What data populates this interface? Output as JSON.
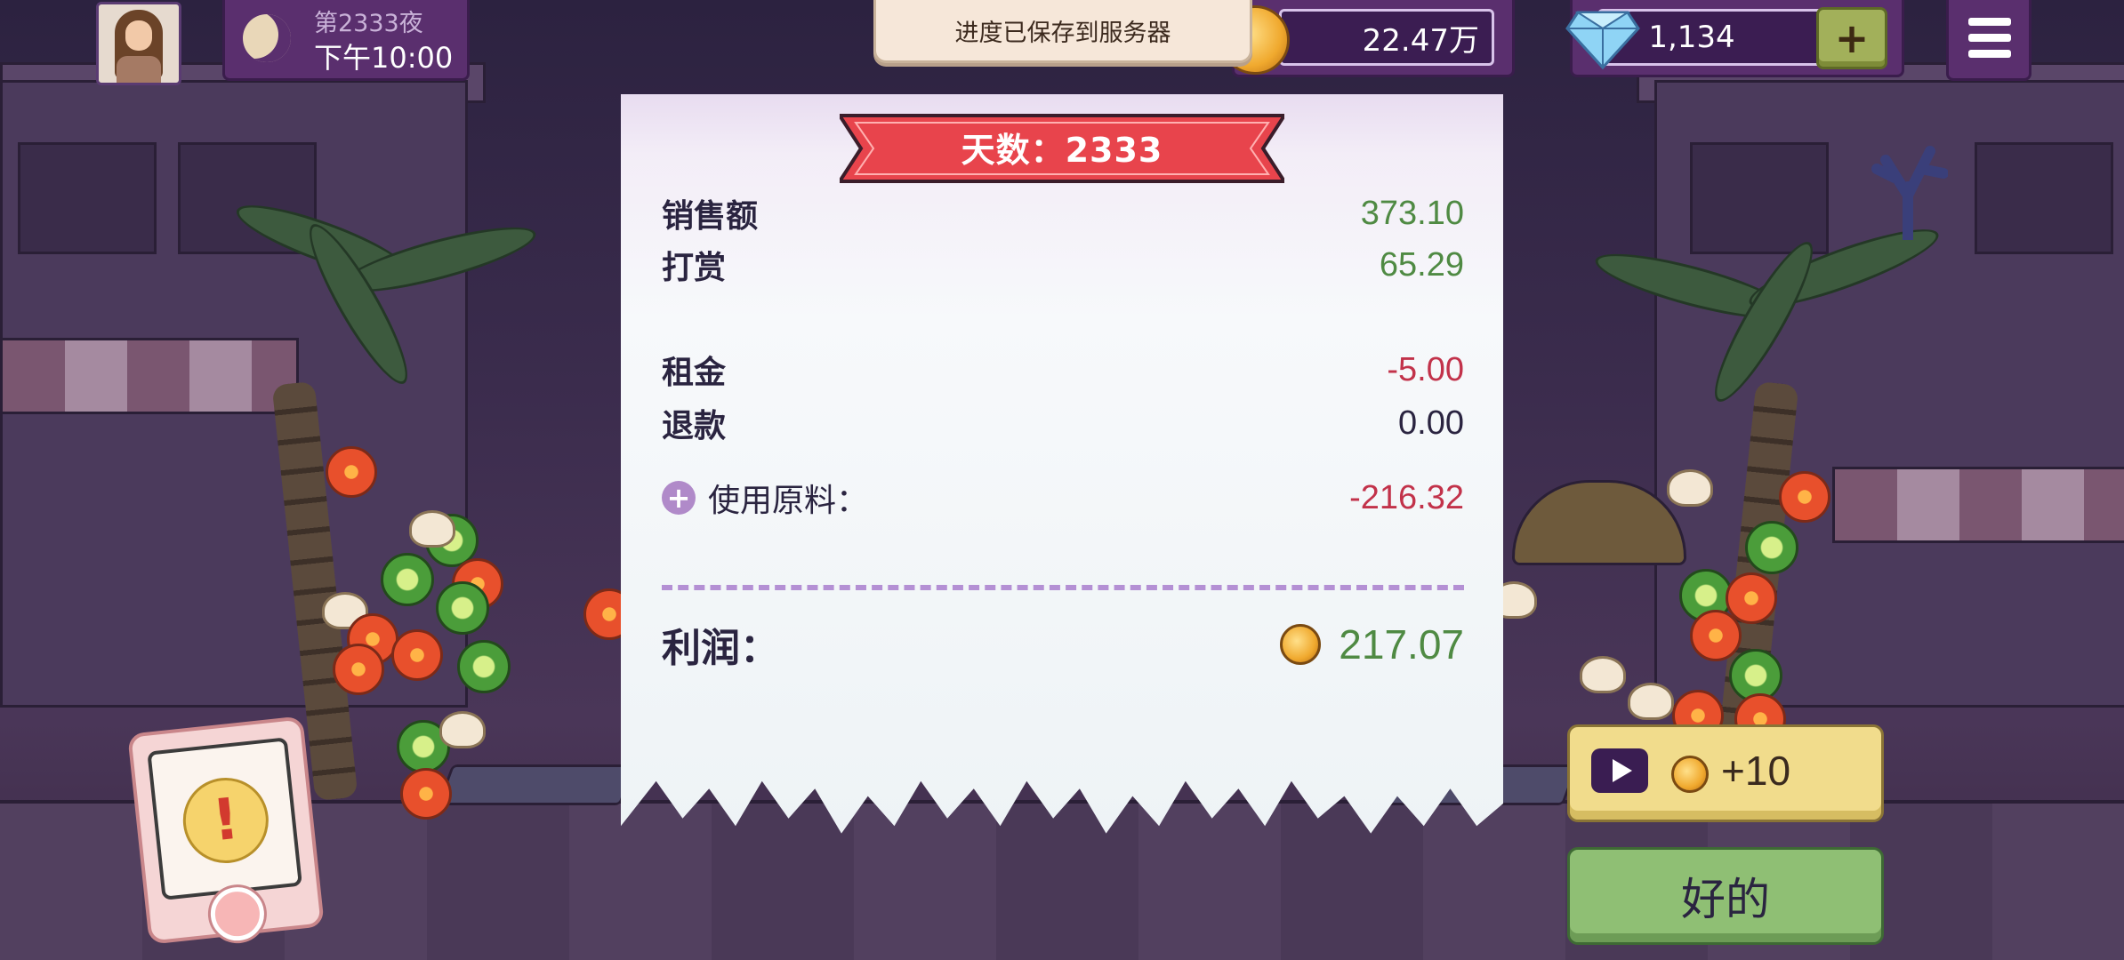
{
  "hud": {
    "night_label": "第2333夜",
    "time_label": "下午10:00",
    "toast": "进度已保存到服务器",
    "coins": "22.47万",
    "gems": "1,134",
    "plus_label": "+"
  },
  "receipt": {
    "day_title": "天数：2333",
    "rows": [
      {
        "label": "销售额",
        "value": "373.10"
      },
      {
        "label": "打赏",
        "value": "65.29"
      },
      {
        "label": "租金",
        "value": "-5.00"
      },
      {
        "label": "退款",
        "value": "0.00"
      },
      {
        "label": "使用原料：",
        "value": "-216.32"
      }
    ],
    "profit_label": "利润：",
    "profit_value": "217.07"
  },
  "buttons": {
    "ad_reward": "+10",
    "ok": "好的",
    "alert_mark": "!"
  },
  "colors": {
    "positive": "#4f8a43",
    "negative": "#c2324a",
    "ribbon": "#e8444c",
    "ok_button": "#8fbf74",
    "ad_button": "#f1dc8c"
  },
  "icons": [
    "moon-icon",
    "coin-icon",
    "gem-icon",
    "menu-icon",
    "plus-icon",
    "play-icon",
    "alert-icon"
  ]
}
